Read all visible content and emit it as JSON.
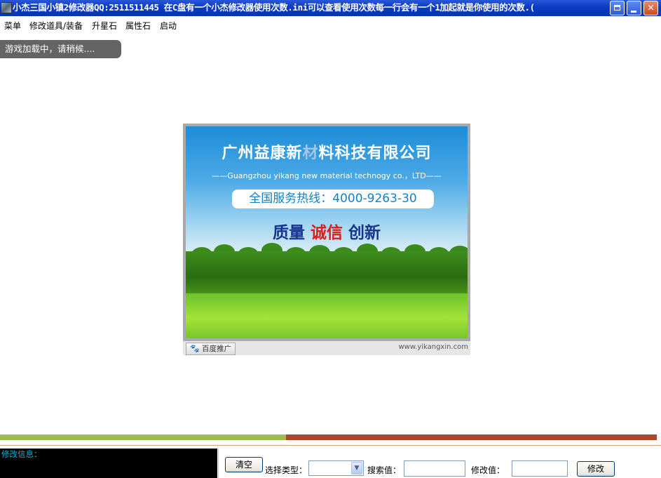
{
  "window": {
    "title": "小杰三国小镇2修改器QQ:2511511445 在C盘有一个小杰修改器使用次数.ini可以查看使用次数每一行会有一个1加起就是你使用的次数.(",
    "controls": {
      "restore": "restore-icon",
      "minimize": "minimize-icon",
      "close": "✕"
    }
  },
  "menu": {
    "items": [
      "菜单",
      "修改道具/装备",
      "升星石",
      "属性石",
      "启动"
    ]
  },
  "status": {
    "loading": "游戏加载中，请稍候...."
  },
  "ad": {
    "title_part1": "广州益康新",
    "title_faded": "材",
    "title_part2": "料科技有限公司",
    "subtitle": "——Guangzhou yikang new material technogy co.，LTD——",
    "hotline": "全国服务热线：4000-9263-30",
    "slogan_1": "质量",
    "slogan_2": "诚信",
    "slogan_3": "创新",
    "footer_badge": "百度推广",
    "footer_url": "www.yikangxin.com"
  },
  "progress": {
    "value": 0.435,
    "fill_color": "#9bbd4f",
    "track_color": "#a74826"
  },
  "bottom": {
    "info_label": "修改信息：",
    "clear_button": "清空",
    "type_label": "选择类型：",
    "type_value": "",
    "search_label": "搜索值：",
    "search_value": "",
    "modify_label": "修改值：",
    "modify_value": "",
    "modify_button": "修改"
  }
}
